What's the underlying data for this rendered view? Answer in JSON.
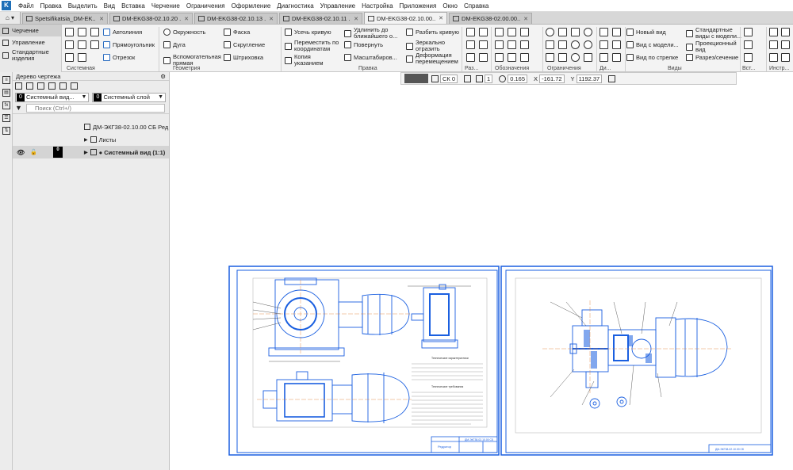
{
  "menu": [
    "Файл",
    "Правка",
    "Выделить",
    "Вид",
    "Вставка",
    "Черчение",
    "Ограничения",
    "Оформление",
    "Диагностика",
    "Управление",
    "Настройка",
    "Приложения",
    "Окно",
    "Справка"
  ],
  "tabs": [
    {
      "label": "Spetsifikatsia_DM-EK...",
      "active": false
    },
    {
      "label": "DM-EKG38-02.10.20 ...",
      "active": false
    },
    {
      "label": "DM-EKG38-02.10.13 ...",
      "active": false
    },
    {
      "label": "DM-EKG38-02.10.11 ...",
      "active": false
    },
    {
      "label": "DM-EKG38-02.10.00....",
      "active": true
    },
    {
      "label": "DM-EKG38-02.00.00....",
      "active": false
    }
  ],
  "nav": {
    "items": [
      "Черчение",
      "Управление",
      "Стандартные изделия"
    ],
    "selected": "Черчение"
  },
  "ribbon": {
    "system": {
      "buttons": [
        "Автолиния",
        "Прямоугольник",
        "Отрезок"
      ],
      "label": "Системная"
    },
    "geometry": {
      "buttons": [
        "Окружность",
        "Дуга",
        "Вспомогательная прямая",
        "Фаска",
        "Скругление",
        "Штриховка"
      ],
      "label": "Геометрия"
    },
    "edit": {
      "buttons": [
        "Усечь кривую",
        "Переместить по координатам",
        "Копия указанием",
        "Удлинить до ближайшего о...",
        "Повернуть",
        "Масштабиров...",
        "Разбить кривую",
        "Зеркально отразить",
        "Деформация перемещением"
      ],
      "label": "Правка"
    },
    "groups": [
      "Раз...",
      "Обозначения",
      "Ограничения",
      "Ди...",
      "Виды",
      "Вст...",
      "Инстр..."
    ],
    "views": {
      "buttons": [
        "Новый вид",
        "Вид с модели...",
        "Вид по стрелке",
        "Стандартные виды с модели...",
        "Проекционный вид",
        "Разрез/сечение"
      ]
    }
  },
  "tree": {
    "title": "Дерево чертежа",
    "view_badge": "0",
    "view_combo": "Системный вид...",
    "layer_badge": "0",
    "layer_combo": "Системный слой",
    "search_placeholder": "Поиск (Ctrl+/)",
    "doc_name": "ДМ-ЭКГ38-02.10.00 СБ Ред",
    "sheets": "Листы",
    "system_view": "● Системный вид (1:1)",
    "system_view_badge": "0"
  },
  "cmdbar": {
    "cs": "СК 0",
    "style": "1",
    "zoom": "0.165",
    "x_label": "X",
    "x": "-161.72",
    "y_label": "Y",
    "y": "1192.37"
  },
  "drawing": {
    "sheet1_stamp": "ДМ-ЭКГ38-02.10.00 СБ",
    "sheet1_title": "Редуктор",
    "sheet2_stamp": "ДМ-ЭКГ38-02.10.00 СБ",
    "tech_title": "Технические характеристики",
    "req_title": "Технические требования",
    "line_color": "#1a5fe0"
  }
}
